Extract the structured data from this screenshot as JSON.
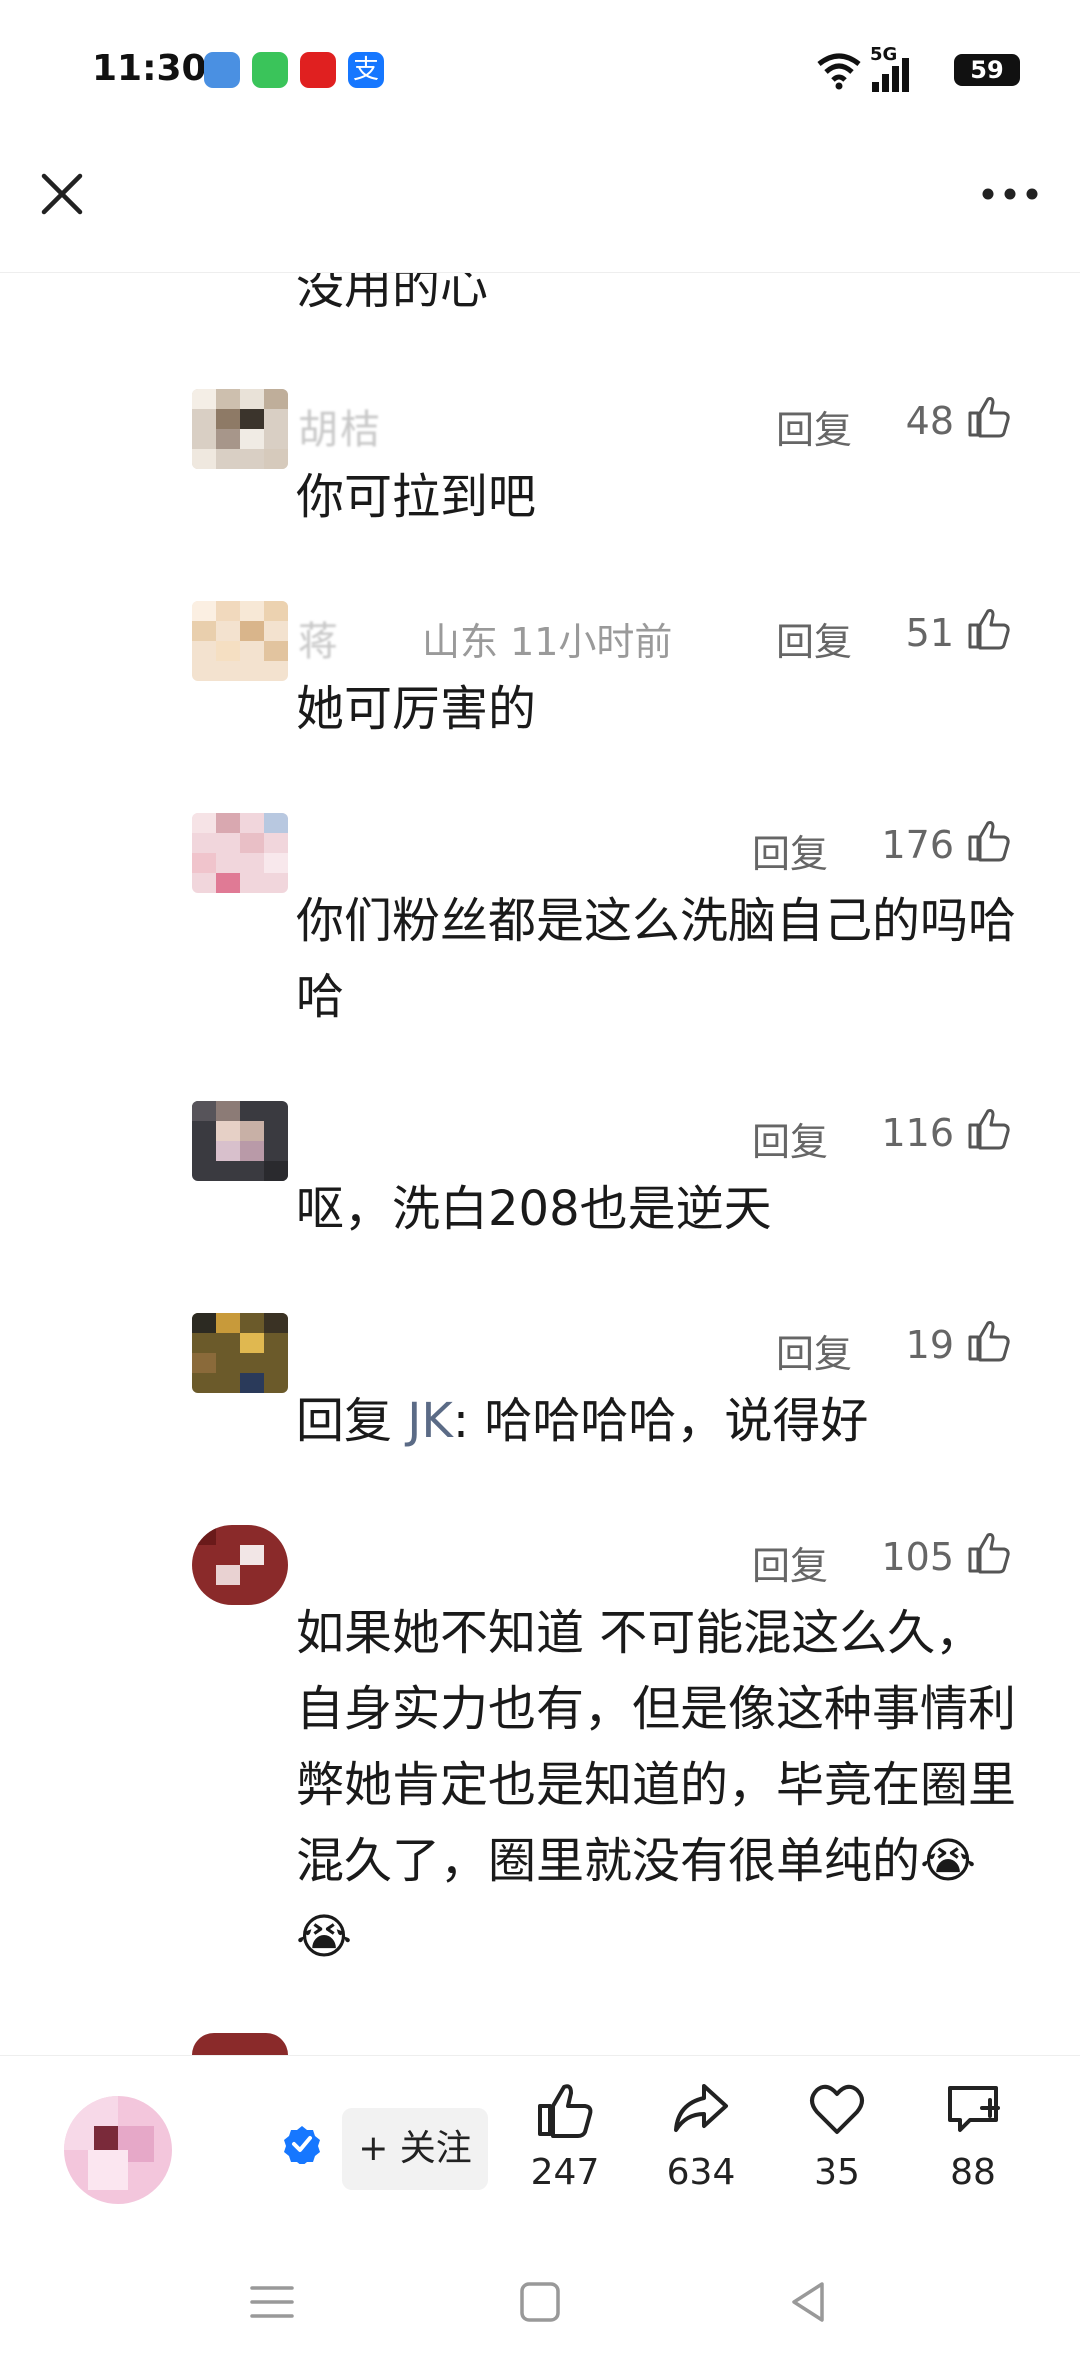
{
  "status_bar": {
    "time": "11:30",
    "network": "5G",
    "battery": "59"
  },
  "top_bar": {
    "close_icon": "close-icon",
    "more_icon": "more-icon"
  },
  "partial_text": "没用的心",
  "comments": [
    {
      "name": "胡桔 ",
      "meta": "",
      "reply_label": "回复",
      "likes": "48",
      "text": "你可拉到吧"
    },
    {
      "name": "蒋 ",
      "meta": "山东 11小时前",
      "reply_label": "回复",
      "likes": "51",
      "text": "她可厉害的"
    },
    {
      "name": "",
      "meta": "",
      "reply_label": "回复",
      "likes": "176",
      "text": "你们粉丝都是这么洗脑自己的吗哈哈"
    },
    {
      "name": "",
      "meta": "",
      "reply_label": "回复",
      "likes": "116",
      "text": "呕，洗白208也是逆天"
    },
    {
      "name": "",
      "meta": "",
      "reply_label": "回复",
      "likes": "19",
      "text_prefix": "回复 ",
      "reply_target": "JK",
      "text_suffix": ": 哈哈哈哈，说得好"
    },
    {
      "name": "",
      "meta": "",
      "reply_label": "回复",
      "likes": "105",
      "text": "如果她不知道 不可能混这么久，自身实力也有，但是像这种事情利弊她肯定也是知道的，毕竟在圈里混久了，圈里就没有很单纯的😭😭"
    }
  ],
  "bottom_bar": {
    "author_name": "",
    "follow_label": "+ 关注",
    "like_count": "247",
    "share_count": "634",
    "favorite_count": "35",
    "comment_count": "88"
  },
  "colors": {
    "text": "#1a1a1a",
    "meta": "#9a9a9a",
    "reply_target": "#5b6b86",
    "verified": "#1677ff"
  }
}
